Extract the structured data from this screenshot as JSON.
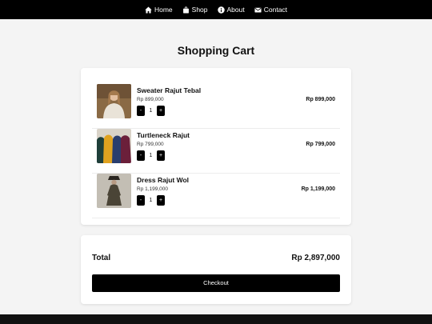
{
  "nav": {
    "items": [
      {
        "label": "Home",
        "icon": "home-icon"
      },
      {
        "label": "Shop",
        "icon": "shopping-bag-icon"
      },
      {
        "label": "About",
        "icon": "info-icon"
      },
      {
        "label": "Contact",
        "icon": "envelope-icon"
      }
    ]
  },
  "page": {
    "title": "Shopping Cart"
  },
  "cart": {
    "items": [
      {
        "name": "Sweater Rajut Tebal",
        "price": "Rp 899,000",
        "quantity": "1",
        "total": "Rp 899,000",
        "minus_label": "-",
        "plus_label": "+",
        "image": "sweater-photo"
      },
      {
        "name": "Turtleneck Rajut",
        "price": "Rp 799,000",
        "quantity": "1",
        "total": "Rp 799,000",
        "minus_label": "-",
        "plus_label": "+",
        "image": "turtleneck-photo"
      },
      {
        "name": "Dress Rajut Wol",
        "price": "Rp 1,199,000",
        "quantity": "1",
        "total": "Rp 1,199,000",
        "minus_label": "-",
        "plus_label": "+",
        "image": "dress-photo"
      }
    ]
  },
  "summary": {
    "total_label": "Total",
    "total_value": "Rp 2,897,000",
    "checkout_label": "Checkout"
  },
  "colors": {
    "navbar": "#000000",
    "page_background": "#f4f4f4",
    "card": "#ffffff",
    "button": "#000000"
  }
}
